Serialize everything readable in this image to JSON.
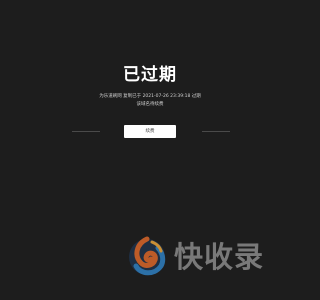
{
  "page": {
    "title": "已过期",
    "message_line1": "为乐道刷网 复制已于 2021-07-26 23:39:18 过期",
    "message_line2": "该域名待续费",
    "button_label": "续费"
  },
  "watermark": {
    "text": "快收录",
    "logo_icon": "flame-swirl-logo-icon",
    "colors": [
      "#d8662a",
      "#2f7fc0",
      "#e8a33a"
    ]
  },
  "colors": {
    "background": "#1d1d1d",
    "title": "#ffffff",
    "message": "#cfcfcf",
    "button_bg": "#ffffff",
    "divider": "#4a4a4a"
  }
}
